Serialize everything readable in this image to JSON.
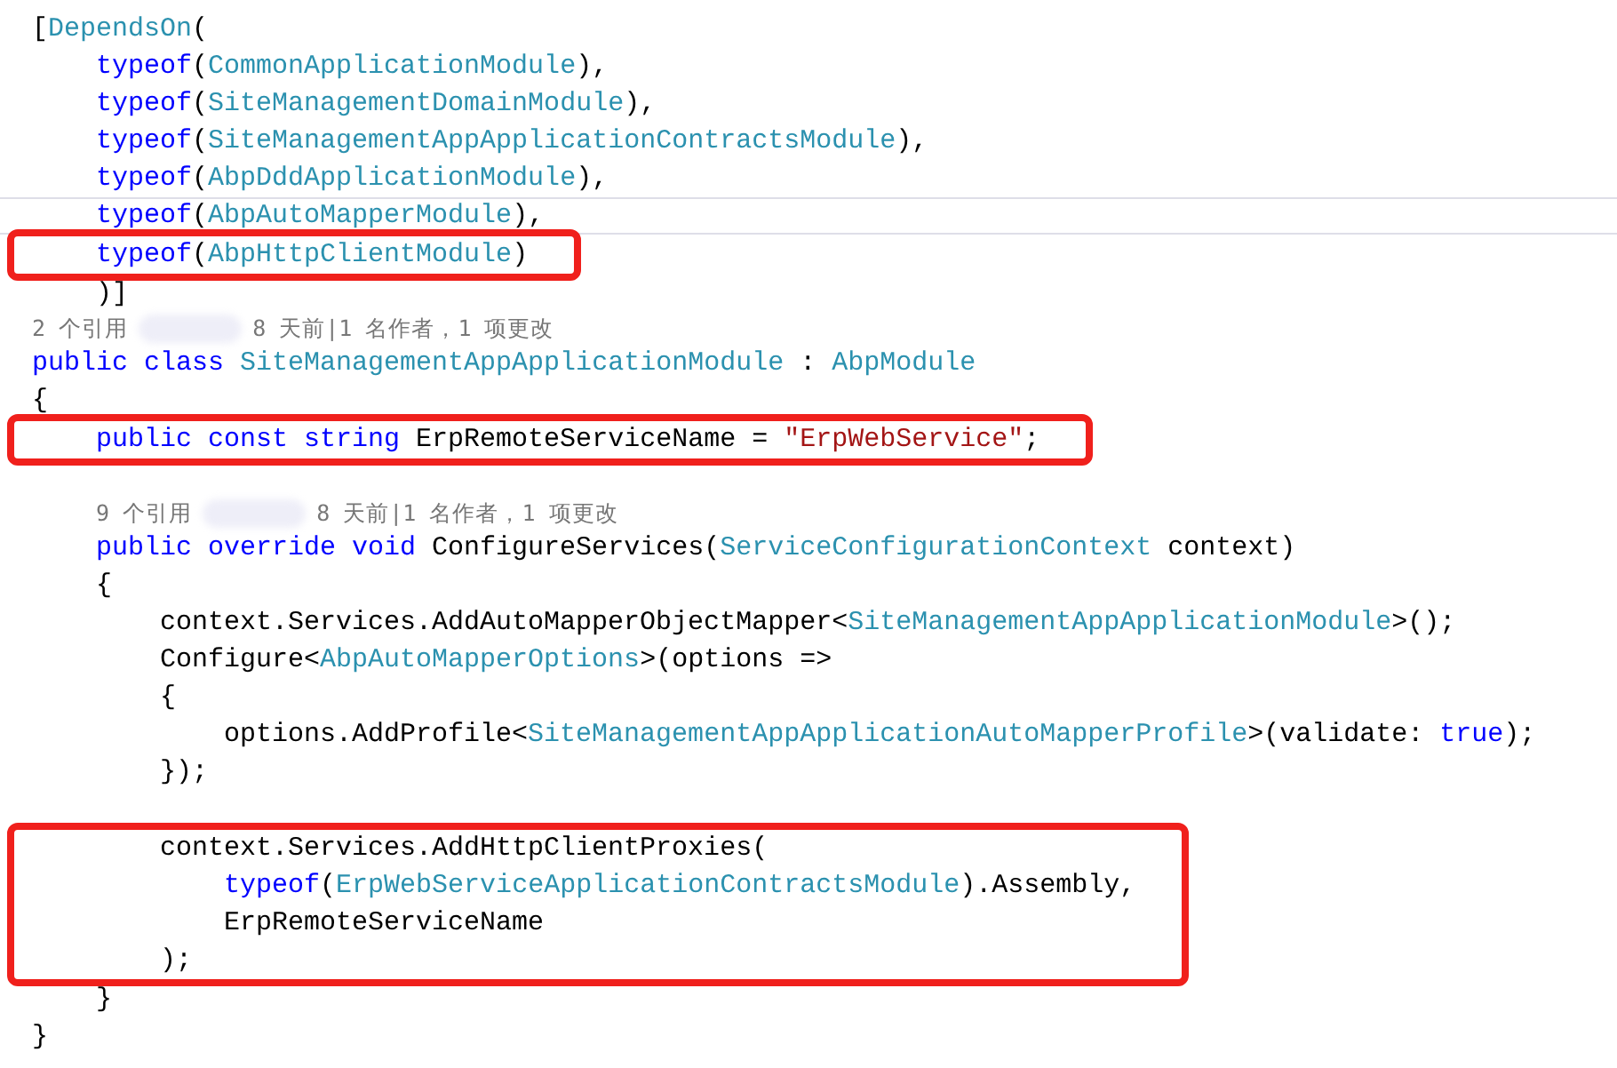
{
  "blocks": [
    {
      "boxed": false,
      "lines": [
        {
          "kind": "code",
          "tokens": [
            {
              "text": "[",
              "kind": "plain"
            },
            {
              "text": "DependsOn",
              "kind": "type"
            },
            {
              "text": "(",
              "kind": "plain"
            }
          ]
        },
        {
          "kind": "code",
          "tokens": [
            {
              "text": "    typeof",
              "kind": "keyword"
            },
            {
              "text": "(",
              "kind": "plain"
            },
            {
              "text": "CommonApplicationModule",
              "kind": "type"
            },
            {
              "text": "),",
              "kind": "plain"
            }
          ]
        },
        {
          "kind": "code",
          "tokens": [
            {
              "text": "    typeof",
              "kind": "keyword"
            },
            {
              "text": "(",
              "kind": "plain"
            },
            {
              "text": "SiteManagementDomainModule",
              "kind": "type"
            },
            {
              "text": "),",
              "kind": "plain"
            }
          ]
        },
        {
          "kind": "code",
          "tokens": [
            {
              "text": "    typeof",
              "kind": "keyword"
            },
            {
              "text": "(",
              "kind": "plain"
            },
            {
              "text": "SiteManagementAppApplicationContractsModule",
              "kind": "type"
            },
            {
              "text": "),",
              "kind": "plain"
            }
          ]
        },
        {
          "kind": "code",
          "tokens": [
            {
              "text": "    typeof",
              "kind": "keyword"
            },
            {
              "text": "(",
              "kind": "plain"
            },
            {
              "text": "AbpDddApplicationModule",
              "kind": "type"
            },
            {
              "text": "),",
              "kind": "plain"
            }
          ]
        },
        {
          "kind": "cut",
          "tokens": [
            {
              "text": "    typeof",
              "kind": "keyword"
            },
            {
              "text": "(",
              "kind": "plain"
            },
            {
              "text": "AbpAutoMapperModule",
              "kind": "type"
            },
            {
              "text": "),",
              "kind": "plain"
            }
          ]
        }
      ]
    },
    {
      "boxed": true,
      "lines": [
        {
          "kind": "code",
          "tokens": [
            {
              "text": "    typeof",
              "kind": "keyword"
            },
            {
              "text": "(",
              "kind": "plain"
            },
            {
              "text": "AbpHttpClientModule",
              "kind": "type"
            },
            {
              "text": ")",
              "kind": "plain"
            }
          ]
        }
      ]
    },
    {
      "boxed": false,
      "lines": [
        {
          "kind": "code",
          "tokens": [
            {
              "text": "    )]",
              "kind": "plain"
            }
          ]
        },
        {
          "kind": "codelens",
          "refs": "2 个引用",
          "history": "8 天前|1 名作者，1 项更改"
        },
        {
          "kind": "code",
          "tokens": [
            {
              "text": "public class ",
              "kind": "keyword"
            },
            {
              "text": "SiteManagementAppApplicationModule",
              "kind": "type"
            },
            {
              "text": " : ",
              "kind": "plain"
            },
            {
              "text": "AbpModule",
              "kind": "type"
            }
          ]
        },
        {
          "kind": "code",
          "tokens": [
            {
              "text": "{",
              "kind": "plain"
            }
          ]
        }
      ]
    },
    {
      "boxed": true,
      "lines": [
        {
          "kind": "code",
          "tokens": [
            {
              "text": "    public const string ",
              "kind": "keyword"
            },
            {
              "text": "ErpRemoteServiceName = ",
              "kind": "plain"
            },
            {
              "text": "\"ErpWebService\"",
              "kind": "string"
            },
            {
              "text": ";",
              "kind": "plain"
            }
          ]
        }
      ]
    },
    {
      "boxed": false,
      "lines": [
        {
          "kind": "blank"
        },
        {
          "kind": "codelens",
          "refs": "    9 个引用",
          "history": "8 天前|1 名作者，1 项更改"
        },
        {
          "kind": "code",
          "tokens": [
            {
              "text": "    public override void ",
              "kind": "keyword"
            },
            {
              "text": "ConfigureServices(",
              "kind": "plain"
            },
            {
              "text": "ServiceConfigurationContext",
              "kind": "type"
            },
            {
              "text": " context)",
              "kind": "plain"
            }
          ]
        },
        {
          "kind": "code",
          "tokens": [
            {
              "text": "    {",
              "kind": "plain"
            }
          ]
        },
        {
          "kind": "code",
          "tokens": [
            {
              "text": "        context.Services.AddAutoMapperObjectMapper<",
              "kind": "plain"
            },
            {
              "text": "SiteManagementAppApplicationModule",
              "kind": "type"
            },
            {
              "text": ">();",
              "kind": "plain"
            }
          ]
        },
        {
          "kind": "code",
          "tokens": [
            {
              "text": "        Configure<",
              "kind": "plain"
            },
            {
              "text": "AbpAutoMapperOptions",
              "kind": "type"
            },
            {
              "text": ">(options =>",
              "kind": "plain"
            }
          ]
        },
        {
          "kind": "code",
          "tokens": [
            {
              "text": "        {",
              "kind": "plain"
            }
          ]
        },
        {
          "kind": "code",
          "tokens": [
            {
              "text": "            options.AddProfile<",
              "kind": "plain"
            },
            {
              "text": "SiteManagementAppApplicationAutoMapperProfile",
              "kind": "type"
            },
            {
              "text": ">(validate: ",
              "kind": "plain"
            },
            {
              "text": "true",
              "kind": "keyword"
            },
            {
              "text": ");",
              "kind": "plain"
            }
          ]
        },
        {
          "kind": "code",
          "tokens": [
            {
              "text": "        });",
              "kind": "plain"
            }
          ]
        },
        {
          "kind": "blank"
        }
      ]
    },
    {
      "boxed": true,
      "lines": [
        {
          "kind": "code",
          "tokens": [
            {
              "text": "        context.Services.AddHttpClientProxies(",
              "kind": "plain"
            }
          ]
        },
        {
          "kind": "code",
          "tokens": [
            {
              "text": "            typeof",
              "kind": "keyword"
            },
            {
              "text": "(",
              "kind": "plain"
            },
            {
              "text": "ErpWebServiceApplicationContractsModule",
              "kind": "type"
            },
            {
              "text": ").Assembly,",
              "kind": "plain"
            }
          ]
        },
        {
          "kind": "code",
          "tokens": [
            {
              "text": "            ErpRemoteServiceName",
              "kind": "plain"
            }
          ]
        },
        {
          "kind": "code",
          "tokens": [
            {
              "text": "        );",
              "kind": "plain"
            }
          ]
        }
      ]
    },
    {
      "boxed": false,
      "lines": [
        {
          "kind": "code",
          "tokens": [
            {
              "text": "    }",
              "kind": "plain"
            }
          ]
        },
        {
          "kind": "code",
          "tokens": [
            {
              "text": "}",
              "kind": "plain"
            }
          ]
        }
      ]
    }
  ]
}
